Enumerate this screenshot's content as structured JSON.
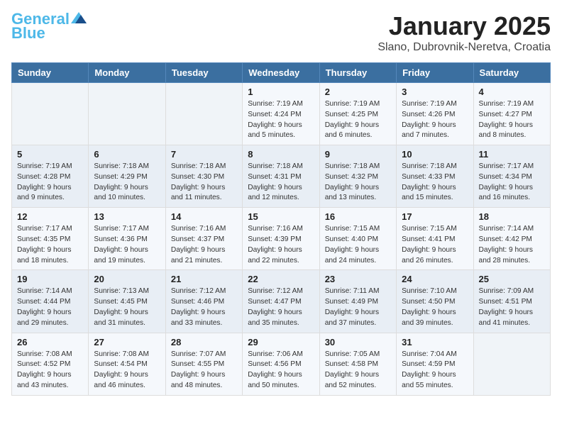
{
  "header": {
    "logo_line1": "General",
    "logo_line2": "Blue",
    "month": "January 2025",
    "location": "Slano, Dubrovnik-Neretva, Croatia"
  },
  "weekdays": [
    "Sunday",
    "Monday",
    "Tuesday",
    "Wednesday",
    "Thursday",
    "Friday",
    "Saturday"
  ],
  "weeks": [
    [
      {
        "day": "",
        "info": ""
      },
      {
        "day": "",
        "info": ""
      },
      {
        "day": "",
        "info": ""
      },
      {
        "day": "1",
        "info": "Sunrise: 7:19 AM\nSunset: 4:24 PM\nDaylight: 9 hours\nand 5 minutes."
      },
      {
        "day": "2",
        "info": "Sunrise: 7:19 AM\nSunset: 4:25 PM\nDaylight: 9 hours\nand 6 minutes."
      },
      {
        "day": "3",
        "info": "Sunrise: 7:19 AM\nSunset: 4:26 PM\nDaylight: 9 hours\nand 7 minutes."
      },
      {
        "day": "4",
        "info": "Sunrise: 7:19 AM\nSunset: 4:27 PM\nDaylight: 9 hours\nand 8 minutes."
      }
    ],
    [
      {
        "day": "5",
        "info": "Sunrise: 7:19 AM\nSunset: 4:28 PM\nDaylight: 9 hours\nand 9 minutes."
      },
      {
        "day": "6",
        "info": "Sunrise: 7:18 AM\nSunset: 4:29 PM\nDaylight: 9 hours\nand 10 minutes."
      },
      {
        "day": "7",
        "info": "Sunrise: 7:18 AM\nSunset: 4:30 PM\nDaylight: 9 hours\nand 11 minutes."
      },
      {
        "day": "8",
        "info": "Sunrise: 7:18 AM\nSunset: 4:31 PM\nDaylight: 9 hours\nand 12 minutes."
      },
      {
        "day": "9",
        "info": "Sunrise: 7:18 AM\nSunset: 4:32 PM\nDaylight: 9 hours\nand 13 minutes."
      },
      {
        "day": "10",
        "info": "Sunrise: 7:18 AM\nSunset: 4:33 PM\nDaylight: 9 hours\nand 15 minutes."
      },
      {
        "day": "11",
        "info": "Sunrise: 7:17 AM\nSunset: 4:34 PM\nDaylight: 9 hours\nand 16 minutes."
      }
    ],
    [
      {
        "day": "12",
        "info": "Sunrise: 7:17 AM\nSunset: 4:35 PM\nDaylight: 9 hours\nand 18 minutes."
      },
      {
        "day": "13",
        "info": "Sunrise: 7:17 AM\nSunset: 4:36 PM\nDaylight: 9 hours\nand 19 minutes."
      },
      {
        "day": "14",
        "info": "Sunrise: 7:16 AM\nSunset: 4:37 PM\nDaylight: 9 hours\nand 21 minutes."
      },
      {
        "day": "15",
        "info": "Sunrise: 7:16 AM\nSunset: 4:39 PM\nDaylight: 9 hours\nand 22 minutes."
      },
      {
        "day": "16",
        "info": "Sunrise: 7:15 AM\nSunset: 4:40 PM\nDaylight: 9 hours\nand 24 minutes."
      },
      {
        "day": "17",
        "info": "Sunrise: 7:15 AM\nSunset: 4:41 PM\nDaylight: 9 hours\nand 26 minutes."
      },
      {
        "day": "18",
        "info": "Sunrise: 7:14 AM\nSunset: 4:42 PM\nDaylight: 9 hours\nand 28 minutes."
      }
    ],
    [
      {
        "day": "19",
        "info": "Sunrise: 7:14 AM\nSunset: 4:44 PM\nDaylight: 9 hours\nand 29 minutes."
      },
      {
        "day": "20",
        "info": "Sunrise: 7:13 AM\nSunset: 4:45 PM\nDaylight: 9 hours\nand 31 minutes."
      },
      {
        "day": "21",
        "info": "Sunrise: 7:12 AM\nSunset: 4:46 PM\nDaylight: 9 hours\nand 33 minutes."
      },
      {
        "day": "22",
        "info": "Sunrise: 7:12 AM\nSunset: 4:47 PM\nDaylight: 9 hours\nand 35 minutes."
      },
      {
        "day": "23",
        "info": "Sunrise: 7:11 AM\nSunset: 4:49 PM\nDaylight: 9 hours\nand 37 minutes."
      },
      {
        "day": "24",
        "info": "Sunrise: 7:10 AM\nSunset: 4:50 PM\nDaylight: 9 hours\nand 39 minutes."
      },
      {
        "day": "25",
        "info": "Sunrise: 7:09 AM\nSunset: 4:51 PM\nDaylight: 9 hours\nand 41 minutes."
      }
    ],
    [
      {
        "day": "26",
        "info": "Sunrise: 7:08 AM\nSunset: 4:52 PM\nDaylight: 9 hours\nand 43 minutes."
      },
      {
        "day": "27",
        "info": "Sunrise: 7:08 AM\nSunset: 4:54 PM\nDaylight: 9 hours\nand 46 minutes."
      },
      {
        "day": "28",
        "info": "Sunrise: 7:07 AM\nSunset: 4:55 PM\nDaylight: 9 hours\nand 48 minutes."
      },
      {
        "day": "29",
        "info": "Sunrise: 7:06 AM\nSunset: 4:56 PM\nDaylight: 9 hours\nand 50 minutes."
      },
      {
        "day": "30",
        "info": "Sunrise: 7:05 AM\nSunset: 4:58 PM\nDaylight: 9 hours\nand 52 minutes."
      },
      {
        "day": "31",
        "info": "Sunrise: 7:04 AM\nSunset: 4:59 PM\nDaylight: 9 hours\nand 55 minutes."
      },
      {
        "day": "",
        "info": ""
      }
    ]
  ]
}
